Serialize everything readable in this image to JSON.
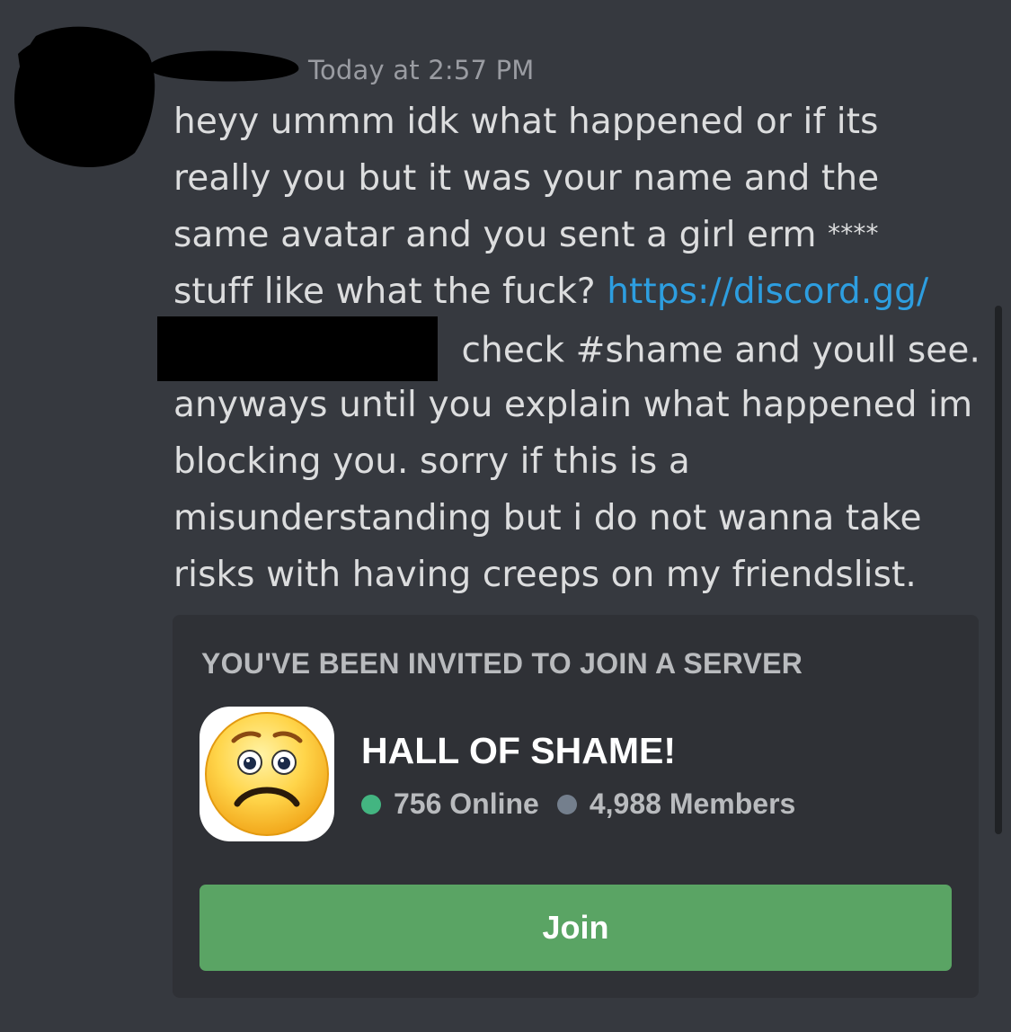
{
  "message": {
    "timestamp": "Today at 2:57 PM",
    "lines": [
      "heyy ummm idk what happened or if its",
      "really you but it was your name and the",
      "same avatar and you sent a girl erm ",
      "stuff like what the fuck? ",
      " check #shame and youll see.",
      "anyways until you explain what happened im",
      "blocking you. sorry if this is a",
      "misunderstanding but i do not wanna take",
      "risks with having creeps on my friendslist."
    ],
    "censored_word": "****",
    "link_text": "https://discord.gg/"
  },
  "invite": {
    "heading": "YOU'VE BEEN INVITED TO JOIN A SERVER",
    "server_name": "HALL OF SHAME!",
    "online_text": "756 Online",
    "members_text": "4,988 Members",
    "join_label": "Join",
    "server_icon": "worried-face-emoji-icon"
  },
  "colors": {
    "background": "#36393f",
    "card": "#2f3136",
    "link": "#2d9ee0",
    "join_button": "#5aa464",
    "online_dot": "#43b581",
    "members_dot": "#747f8d"
  }
}
